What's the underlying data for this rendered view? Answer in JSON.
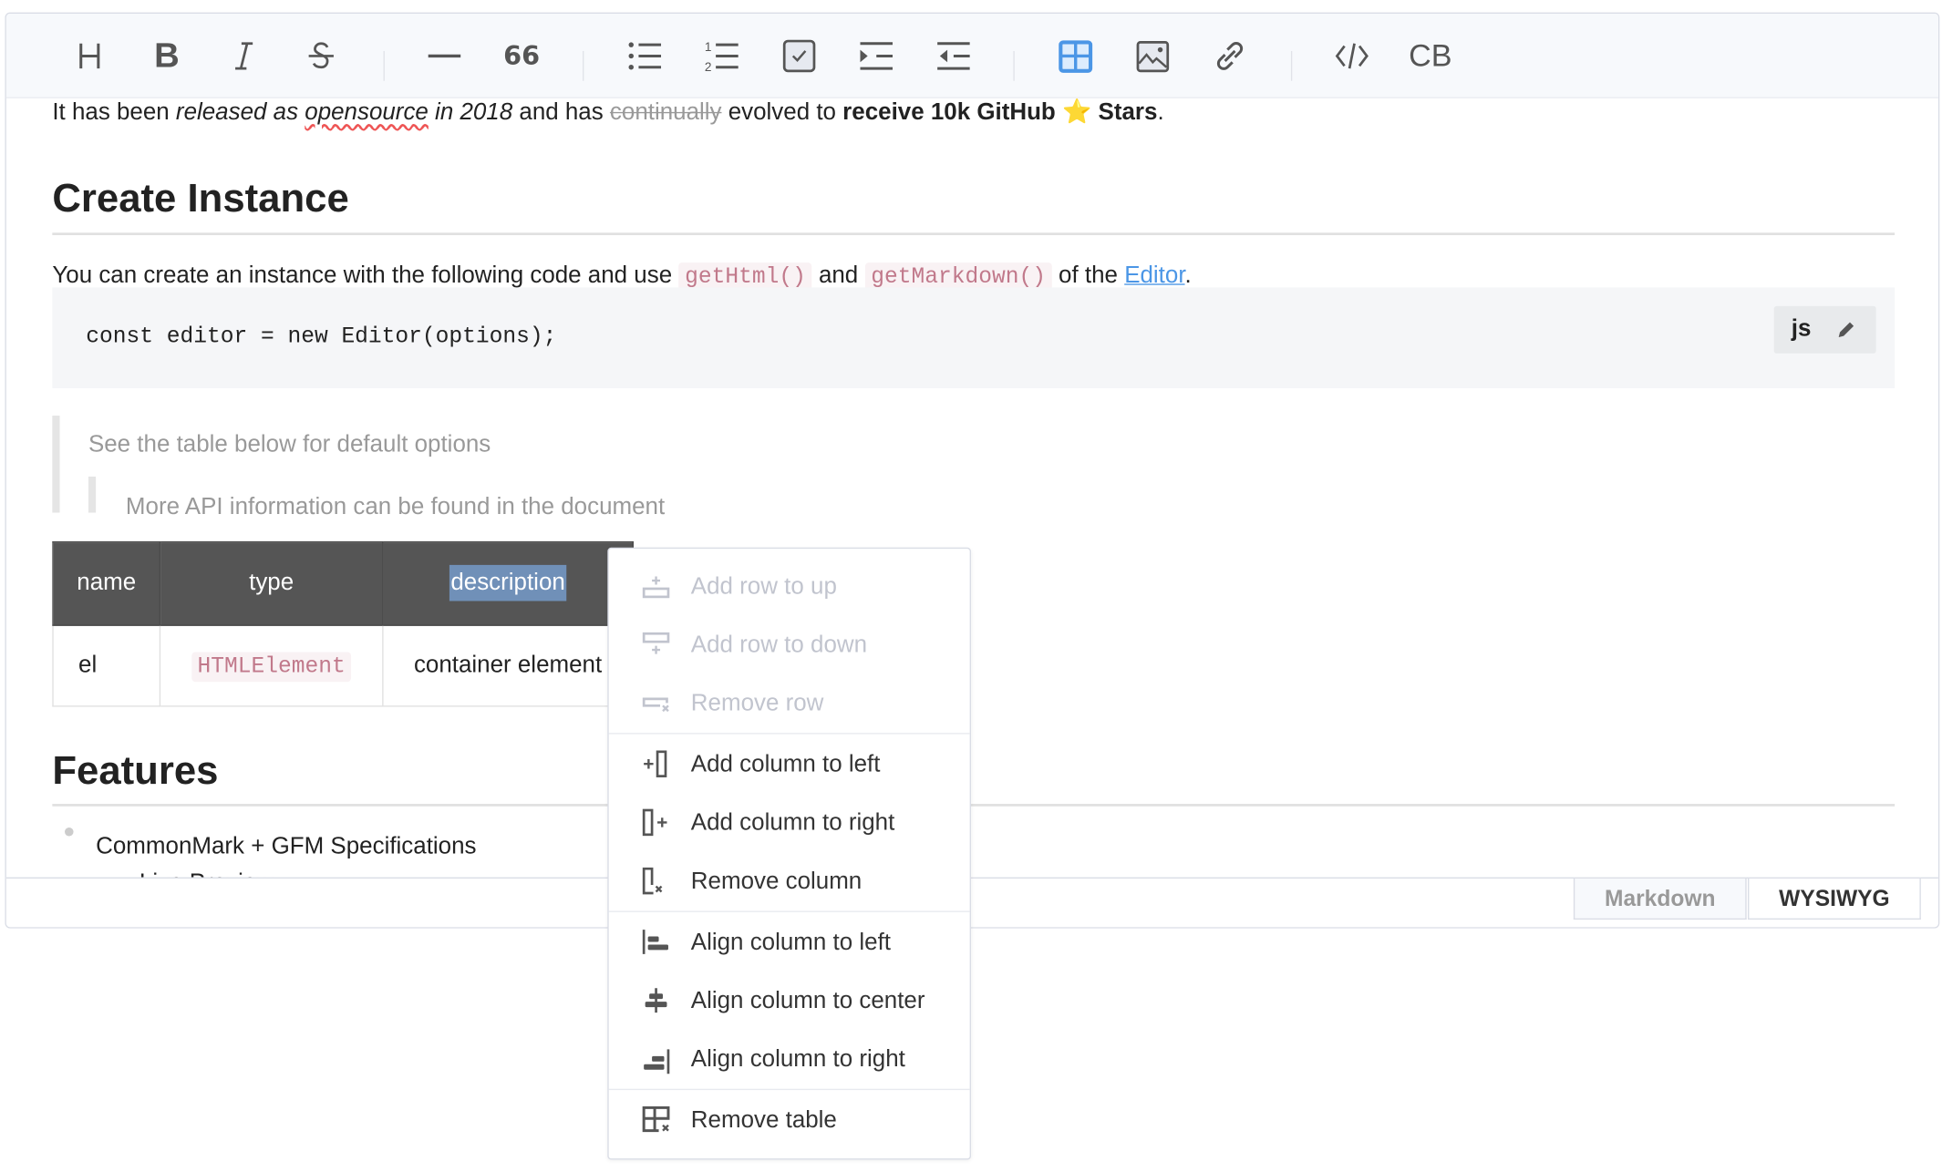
{
  "toolbar": {
    "items": [
      "heading",
      "bold",
      "italic",
      "strike",
      "hr",
      "quote",
      "bullet-list",
      "ordered-list",
      "task-list",
      "indent",
      "outdent",
      "table",
      "image",
      "link",
      "code",
      "codeblock"
    ],
    "codeblock_label": "CB",
    "quote_label": "66",
    "active": "table",
    "accent": "#4b96e6"
  },
  "content": {
    "intro": {
      "p1": "It has been ",
      "em1": "released as ",
      "em_spell": "opensource",
      "em2": " in 2018",
      "p2": " and has ",
      "del": "continually",
      "p3": " evolved to ",
      "strong": "receive 10k GitHub",
      "star": "⭐",
      "strong2": " Stars",
      "p4": "."
    },
    "h_create": "Create Instance",
    "para": {
      "t1": "You can create an instance with the following code and use ",
      "c1": "getHtml()",
      "t2": " and ",
      "c2": "getMarkdown()",
      "t3": " of the ",
      "link": "Editor",
      "t4": "."
    },
    "codeblock": {
      "code": "const editor = new Editor(options);",
      "lang": "js"
    },
    "quote1": "See the table below for default options",
    "quote2": "More API information can be found in the document",
    "table": {
      "headers": [
        "name",
        "type",
        "description"
      ],
      "rows": [
        [
          "el",
          "HTMLElement",
          "container element"
        ]
      ]
    },
    "h_features": "Features",
    "list": [
      "CommonMark + GFM Specifications",
      "Live Preview"
    ]
  },
  "mode_tabs": {
    "markdown": "Markdown",
    "wysiwyg": "WYSIWYG",
    "active": "WYSIWYG"
  },
  "context_menu": {
    "items": [
      {
        "label": "Add row to up",
        "icon": "add-row-up-icon",
        "disabled": true
      },
      {
        "label": "Add row to down",
        "icon": "add-row-down-icon",
        "disabled": true
      },
      {
        "label": "Remove row",
        "icon": "remove-row-icon",
        "disabled": true
      },
      {
        "label": "Add column to left",
        "icon": "add-column-left-icon",
        "disabled": false
      },
      {
        "label": "Add column to right",
        "icon": "add-column-right-icon",
        "disabled": false
      },
      {
        "label": "Remove column",
        "icon": "remove-column-icon",
        "disabled": false
      },
      {
        "label": "Align column to left",
        "icon": "align-left-icon",
        "disabled": false
      },
      {
        "label": "Align column to center",
        "icon": "align-center-icon",
        "disabled": false
      },
      {
        "label": "Align column to right",
        "icon": "align-right-icon",
        "disabled": false
      },
      {
        "label": "Remove table",
        "icon": "remove-table-icon",
        "disabled": false
      }
    ]
  }
}
